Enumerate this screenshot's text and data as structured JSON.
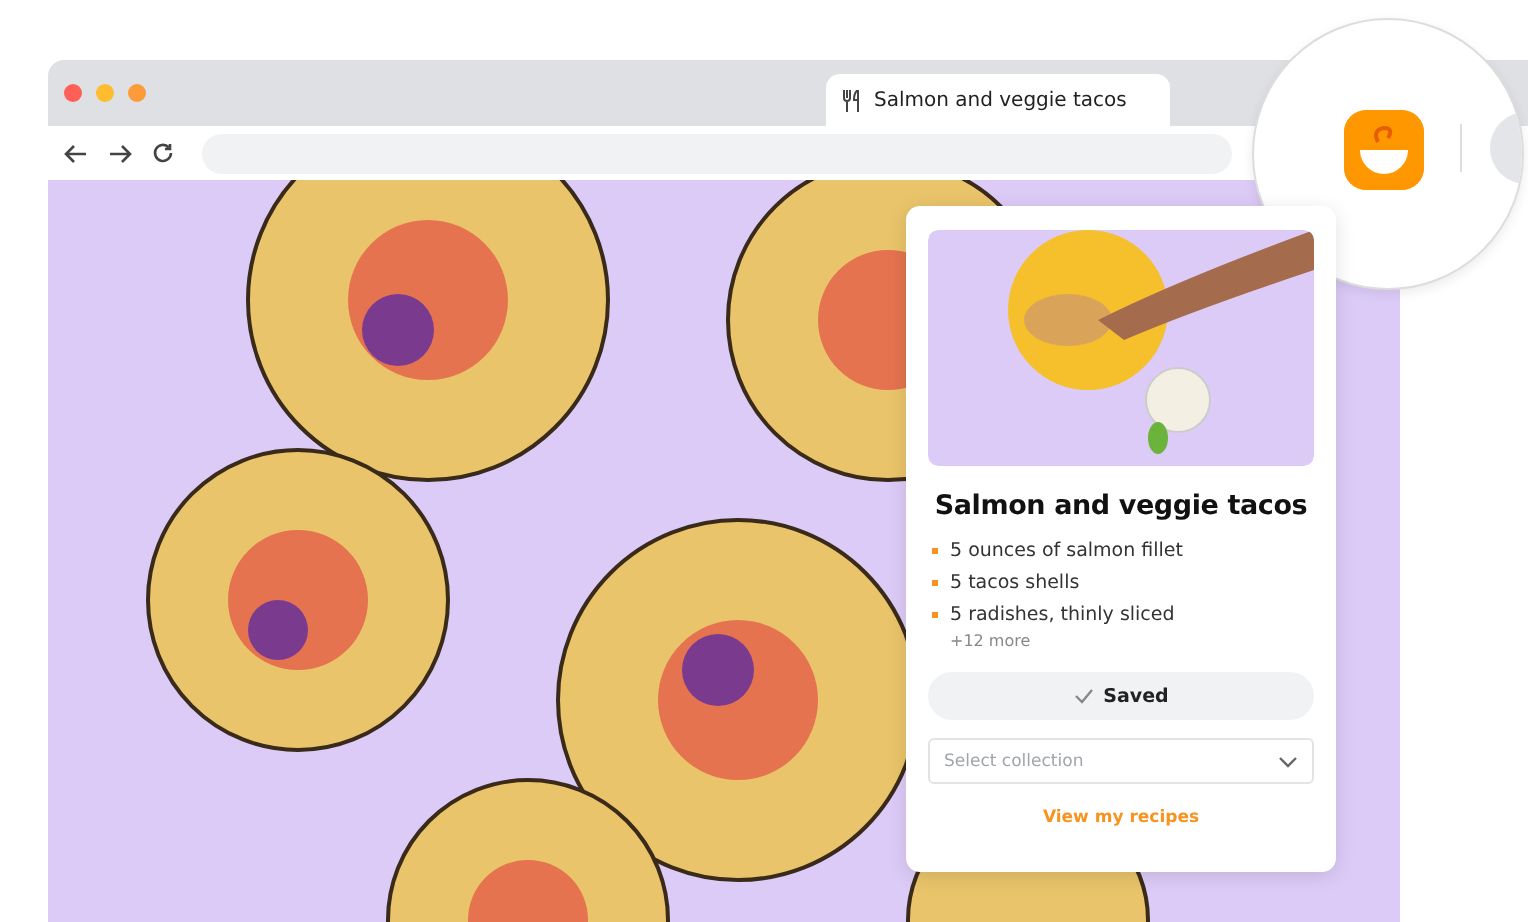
{
  "browser": {
    "tab": {
      "title": "Salmon and veggie tacos",
      "selected": true
    }
  },
  "recipe_card": {
    "title": "Salmon and veggie tacos",
    "ingredients": [
      "5 ounces of salmon fillet",
      "5 tacos shells",
      "5 radishes, thinly sliced"
    ],
    "more": "+12 more",
    "save_button": {
      "label": "Saved",
      "saved": true
    },
    "collection_select": {
      "placeholder": "Select collection"
    },
    "link": "View my recipes"
  }
}
